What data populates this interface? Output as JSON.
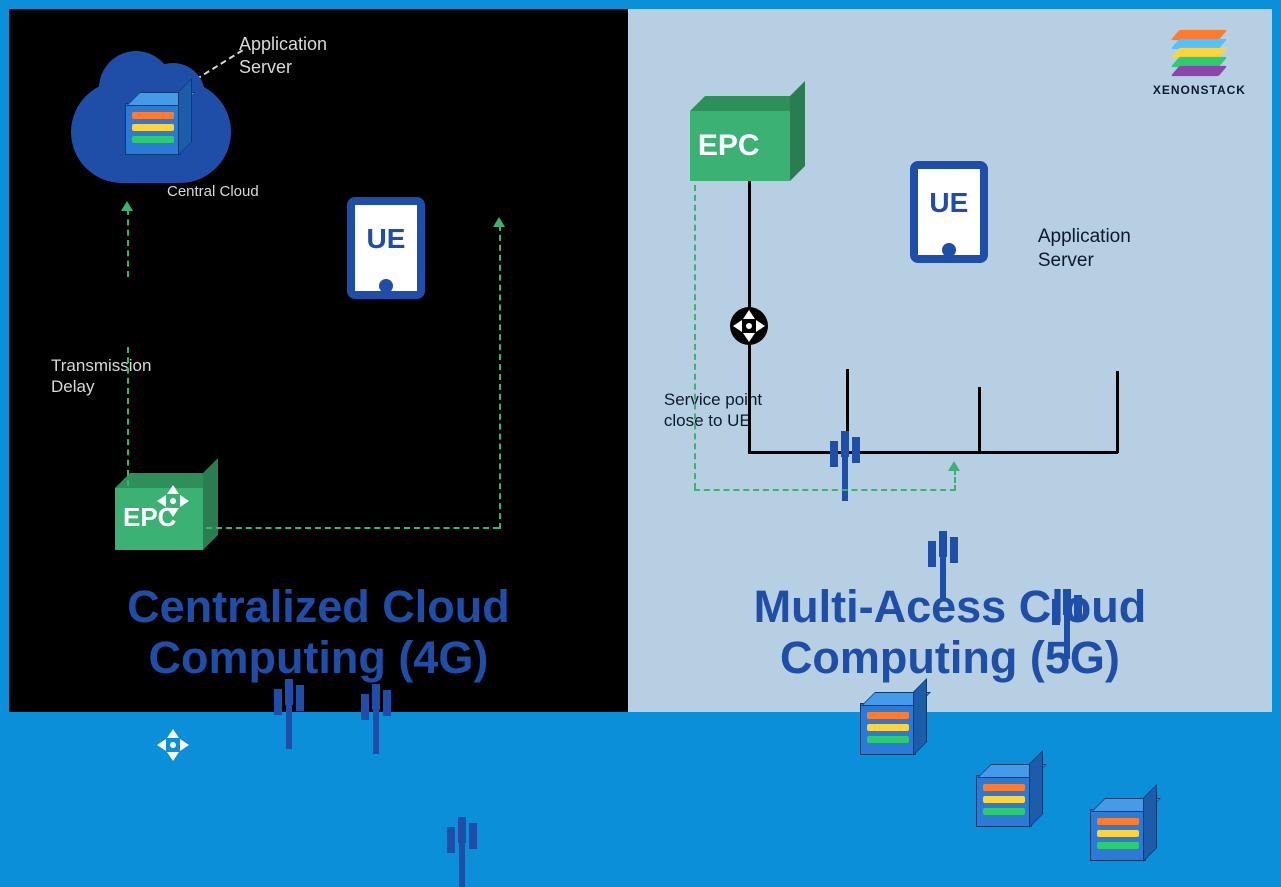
{
  "brand": {
    "name": "XENONSTACK"
  },
  "left": {
    "title": "Centralized Cloud\nComputing (4G)",
    "app_server_label": "Application\nServer",
    "central_cloud_label": "Central Cloud",
    "ue_label": "UE",
    "epc_label": "EPC",
    "transmission_delay_label": "Transmission\nDelay"
  },
  "right": {
    "title": "Multi-Acess Cloud\nComputing (5G)",
    "epc_label": "EPC",
    "ue_label": "UE",
    "app_server_label": "Application\nServer",
    "service_point_label": "Service point\nclose to UE"
  }
}
